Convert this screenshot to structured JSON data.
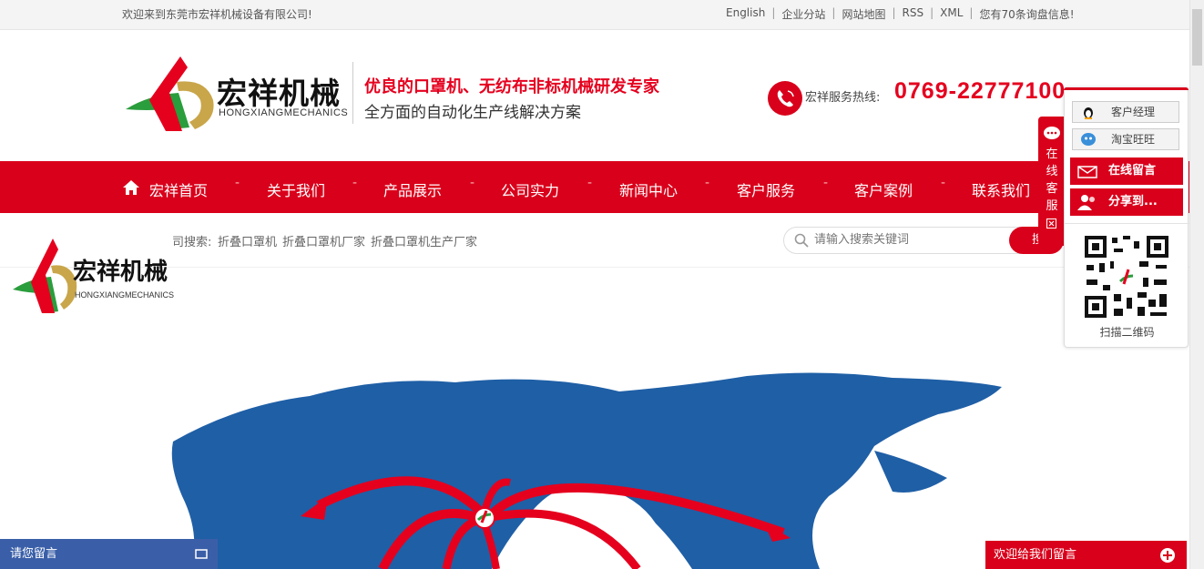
{
  "topbar": {
    "welcome": "欢迎来到东莞市宏祥机械设备有限公司!",
    "links": [
      "English",
      "企业分站",
      "网站地图",
      "RSS",
      "XML",
      "您有70条询盘信息!"
    ]
  },
  "header": {
    "brand_cn": "宏祥机械",
    "brand_en": "HONGXIANGMECHANICS",
    "slogan_main": "优良的口罩机、无纺布非标机械研发专家",
    "slogan_sub": "全方面的自动化生产线解决方案",
    "hotline_label": "宏祥服务热线:",
    "hotline_number": "0769-22777100"
  },
  "nav": {
    "items": [
      "宏祥首页",
      "关于我们",
      "产品展示",
      "公司实力",
      "新闻中心",
      "客户服务",
      "客户案例",
      "联系我们"
    ],
    "separator": "-"
  },
  "search": {
    "hot_label": "司搜索:",
    "hot_keywords": [
      "折叠口罩机",
      "折叠口罩机厂家",
      "折叠口罩机生产厂家"
    ],
    "placeholder": "请输入搜索关键词",
    "button_label": "搜"
  },
  "banner": {
    "logo_cn": "宏祥机械",
    "logo_en": "HONGXIANGMECHANICS"
  },
  "side_service": {
    "tab_label": "在线客服",
    "qq_label": "客户经理",
    "wangwang_label": "淘宝旺旺",
    "message_label": "在线留言",
    "share_label": "分享到...",
    "qr_label": "扫描二维码"
  },
  "footer_widgets": {
    "left_label": "请您留言",
    "right_label": "欢迎给我们留言"
  },
  "colors": {
    "brand_red": "#d9001b",
    "map_blue": "#1f5fa6",
    "topbar_bg": "#f4f4f4"
  }
}
